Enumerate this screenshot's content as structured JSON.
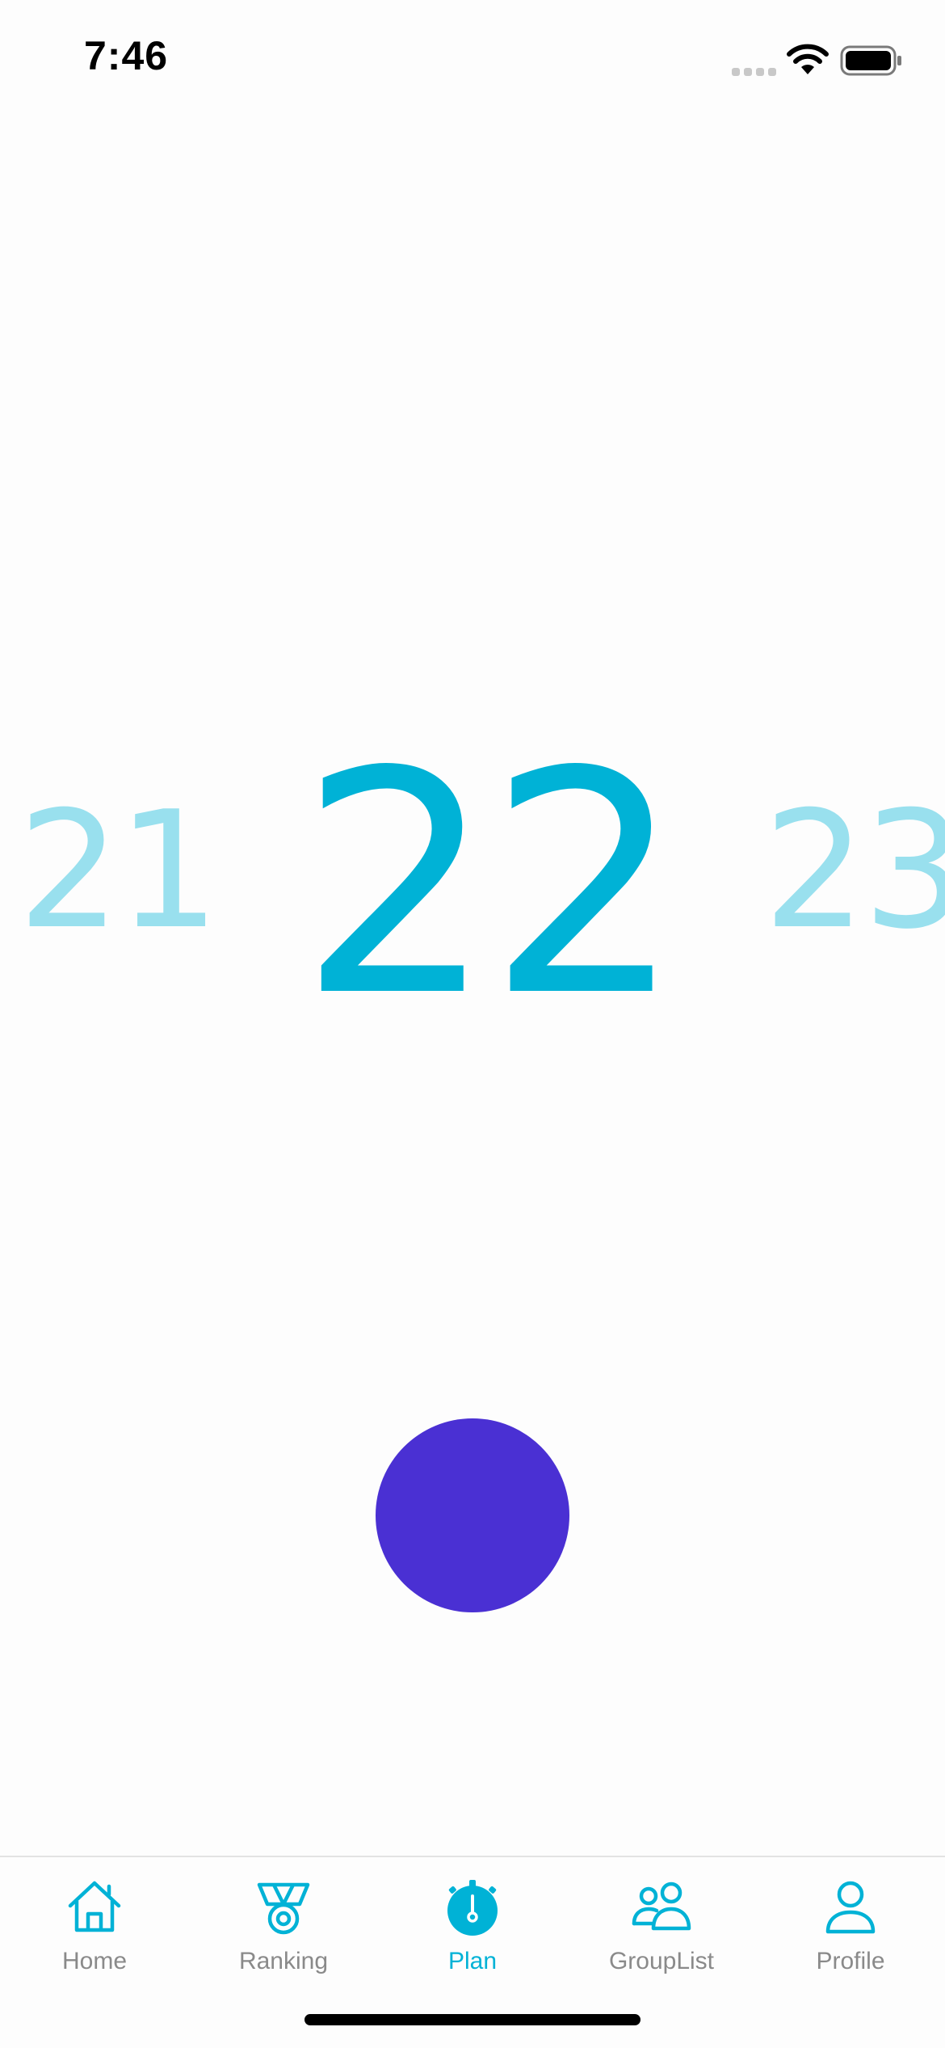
{
  "status_bar": {
    "time": "7:46"
  },
  "picker": {
    "previous": "21",
    "current": "22",
    "next": "23"
  },
  "colors": {
    "accent": "#00b2d6",
    "accent_faded": "#99e0ee",
    "action_circle": "#4a30d3",
    "tab_inactive": "#8a8a8a"
  },
  "tab_bar": {
    "active_tab": "Plan",
    "items": [
      {
        "label": "Home",
        "icon": "home-icon"
      },
      {
        "label": "Ranking",
        "icon": "medal-icon"
      },
      {
        "label": "Plan",
        "icon": "stopwatch-icon"
      },
      {
        "label": "GroupList",
        "icon": "group-icon"
      },
      {
        "label": "Profile",
        "icon": "person-icon"
      }
    ]
  }
}
